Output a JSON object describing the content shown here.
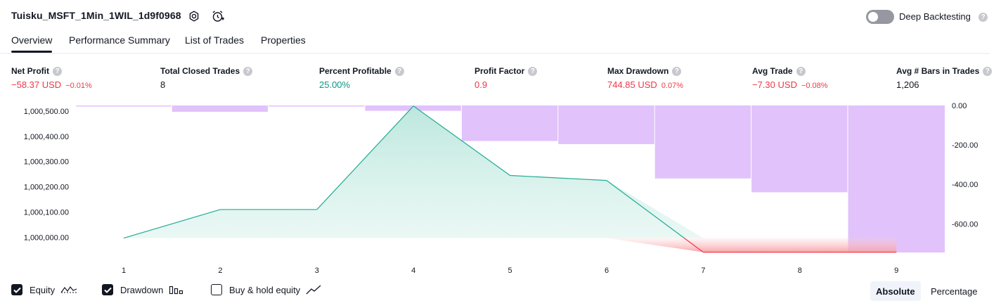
{
  "header": {
    "strategy_name": "Tuisku_MSFT_1Min_1WIL_1d9f0968",
    "settings_icon": "gear-icon",
    "alert_icon": "alarm-clock-add-icon",
    "deep_backtesting_label": "Deep Backtesting",
    "deep_backtesting_enabled": false
  },
  "tabs": [
    {
      "label": "Overview",
      "active": true
    },
    {
      "label": "Performance Summary",
      "active": false
    },
    {
      "label": "List of Trades",
      "active": false
    },
    {
      "label": "Properties",
      "active": false
    }
  ],
  "metrics": [
    {
      "label": "Net Profit",
      "value": "−58.37 USD",
      "pct": "−0.01%",
      "tone": "neg"
    },
    {
      "label": "Total Closed Trades",
      "value": "8",
      "pct": "",
      "tone": ""
    },
    {
      "label": "Percent Profitable",
      "value": "25.00%",
      "pct": "",
      "tone": "pos"
    },
    {
      "label": "Profit Factor",
      "value": "0.9",
      "pct": "",
      "tone": "neg"
    },
    {
      "label": "Max Drawdown",
      "value": "744.85 USD",
      "pct": "0.07%",
      "tone": "neg"
    },
    {
      "label": "Avg Trade",
      "value": "−7.30 USD",
      "pct": "−0.08%",
      "tone": "neg"
    },
    {
      "label": "Avg # Bars in Trades",
      "value": "1,206",
      "pct": "",
      "tone": ""
    }
  ],
  "chart_data": {
    "type": "area",
    "x": [
      1,
      2,
      3,
      4,
      5,
      6,
      7,
      8,
      9
    ],
    "left_axis_ticks": [
      "1,000,500.00",
      "1,000,400.00",
      "1,000,300.00",
      "1,000,200.00",
      "1,000,100.00",
      "1,000,000.00"
    ],
    "right_axis_ticks": [
      "0.00",
      "-200.00",
      "-400.00",
      "-600.00"
    ],
    "left_ylim": [
      999940,
      1000522
    ],
    "right_ylim": [
      -745,
      0
    ],
    "series": [
      {
        "name": "Equity",
        "axis": "left",
        "values": [
          999997,
          1000110,
          1000110,
          1000520,
          1000245,
          1000225,
          999941,
          999941,
          999941
        ]
      },
      {
        "name": "Drawdown",
        "axis": "right",
        "type": "bar",
        "values": [
          -1,
          -32,
          -3,
          -27,
          -180,
          -196,
          -370,
          -440,
          -745
        ]
      }
    ],
    "colors": {
      "equity_line": "#22ab94",
      "equity_fill": "#d1efe8",
      "below_line": "#f23645",
      "below_fill": "#fccbcd",
      "drawdown_bar": "#e1c2fb"
    }
  },
  "legend": {
    "items": [
      {
        "label": "Equity",
        "checked": true,
        "icon": "equity-line-icon"
      },
      {
        "label": "Drawdown",
        "checked": true,
        "icon": "drawdown-bars-icon"
      },
      {
        "label": "Buy & hold equity",
        "checked": false,
        "icon": "buy-hold-line-icon"
      }
    ],
    "mode_options": [
      "Absolute",
      "Percentage"
    ],
    "mode_selected": "Absolute"
  }
}
